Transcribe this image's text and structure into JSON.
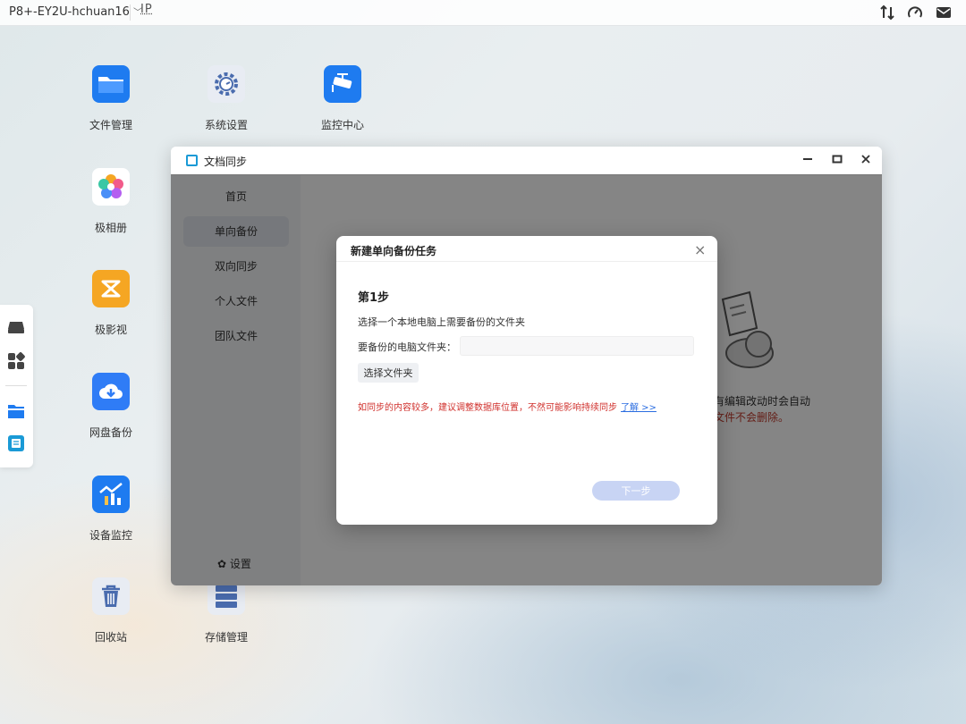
{
  "topbar": {
    "device": "P8+-EY2U-hchuan16",
    "ip_label": "IP",
    "icons": [
      "transfer-icon",
      "speedometer-icon",
      "mail-icon"
    ]
  },
  "desktop": {
    "icons": [
      {
        "label": "文件管理",
        "icon": "folder-icon",
        "color": "#1e7bf0"
      },
      {
        "label": "系统设置",
        "icon": "gear-icon",
        "color": "#4a6cae"
      },
      {
        "label": "监控中心",
        "icon": "cctv-camera-icon",
        "color": "#1e7bf0"
      },
      {
        "label": "极相册",
        "icon": "photo-flower-icon",
        "color": "#f25b8a"
      },
      {
        "label": "极影视",
        "icon": "video-icon",
        "color": "#f5a623"
      },
      {
        "label": "网盘备份",
        "icon": "cloud-download-icon",
        "color": "#2f7cf6"
      },
      {
        "label": "设备监控",
        "icon": "chart-monitor-icon",
        "color": "#1e7bf0"
      },
      {
        "label": "回收站",
        "icon": "trash-icon",
        "color": "#4a6cae"
      },
      {
        "label": "存储管理",
        "icon": "storage-icon",
        "color": "#4a6cae"
      }
    ]
  },
  "dock": {
    "icons": [
      "drive-icon",
      "apps-grid-icon",
      "folder-icon",
      "doc-sync-icon"
    ]
  },
  "window": {
    "title": "文档同步",
    "controls": [
      "minimize-icon",
      "maximize-icon",
      "close-icon"
    ],
    "sidebar": {
      "items": [
        "首页",
        "单向备份",
        "双向同步",
        "个人文件",
        "团队文件"
      ],
      "active_index": 1,
      "settings_label": "设置"
    },
    "content": {
      "desc_line1": "有编辑改动时会自动",
      "desc_line2": "文件不会删除。"
    }
  },
  "dialog": {
    "title": "新建单向备份任务",
    "step": "第1步",
    "instruction": "选择一个本地电脑上需要备份的文件夹",
    "field_label": "要备份的电脑文件夹：",
    "field_value": "",
    "choose_button": "选择文件夹",
    "warning": "如同步的内容较多，建议调整数据库位置，不然可能影响持续同步",
    "learn_more": "了解 >>",
    "next_button": "下一步"
  },
  "colors": {
    "accent": "#1e7bf0",
    "warning": "#d0312d",
    "link": "#2b6de0",
    "next_disabled": "#c8d4f4"
  }
}
